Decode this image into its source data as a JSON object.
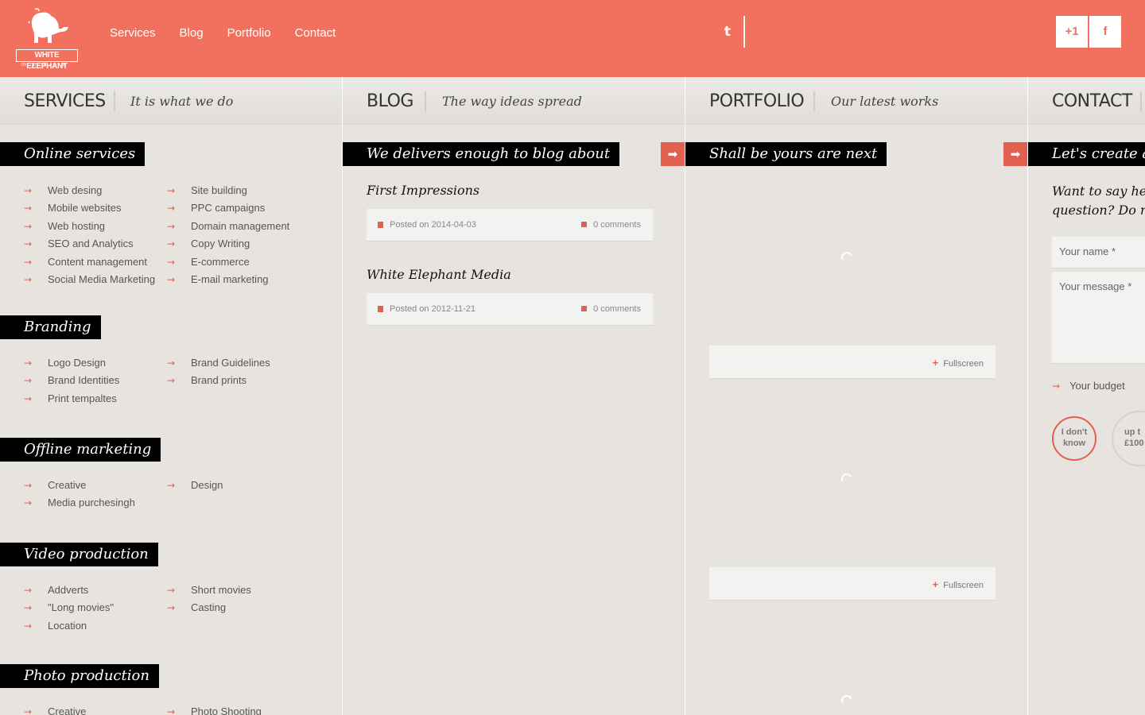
{
  "header": {
    "logo_text": "WHITE ELEPHANT",
    "logo_sub": "media",
    "nav": [
      "Services",
      "Blog",
      "Portfolio",
      "Contact"
    ],
    "twitter_glyph": "t",
    "gplus_glyph": "+1",
    "facebook_glyph": "f",
    "brand_color": "#f2705e",
    "accent_color": "#e2604f"
  },
  "services": {
    "title": "SERVICES",
    "tagline": "It is what we do",
    "groups": [
      {
        "heading": "Online services",
        "left": [
          "Web desing",
          "Mobile websites",
          "Web hosting",
          "SEO and Analytics",
          "Content management",
          "Social Media Marketing"
        ],
        "right": [
          "Site building",
          "PPC campaigns",
          "Domain management",
          "Copy Writing",
          "E-commerce",
          "E-mail marketing"
        ]
      },
      {
        "heading": "Branding",
        "left": [
          "Logo Design",
          "Brand Identities",
          "Print tempaltes"
        ],
        "right": [
          "Brand Guidelines",
          "Brand prints"
        ]
      },
      {
        "heading": "Offline marketing",
        "left": [
          "Creative",
          "Media purchesingh"
        ],
        "right": [
          "Design"
        ]
      },
      {
        "heading": "Video production",
        "left": [
          "Addverts",
          "\"Long movies\"",
          "Location"
        ],
        "right": [
          "Short movies",
          "Casting"
        ]
      },
      {
        "heading": "Photo production",
        "left": [
          "Creative"
        ],
        "right": [
          "Photo Shooting"
        ]
      }
    ]
  },
  "blog": {
    "title": "BLOG",
    "tagline": "The way ideas spread",
    "banner": "We delivers enough to blog about",
    "posts": [
      {
        "title": "First Impressions",
        "date": "Posted on 2014-04-03",
        "comments": "0 comments"
      },
      {
        "title": "White Elephant Media",
        "date": "Posted on 2012-11-21",
        "comments": "0 comments"
      }
    ]
  },
  "portfolio": {
    "title": "PORTFOLIO",
    "tagline": "Our latest works",
    "banner": "Shall be yours are next",
    "fullscreen_label": "Fullscreen"
  },
  "contact": {
    "title": "CONTACT",
    "banner": "Let's create a g",
    "question_line1": "Want to say hell",
    "question_line2": "question? Do no",
    "name_placeholder": "Your name *",
    "message_placeholder": "Your message *",
    "budget_label": "Your budget",
    "budget_opt1_line1": "I don't",
    "budget_opt1_line2": "know",
    "budget_opt2_line1": "up t",
    "budget_opt2_line2": "£100"
  }
}
